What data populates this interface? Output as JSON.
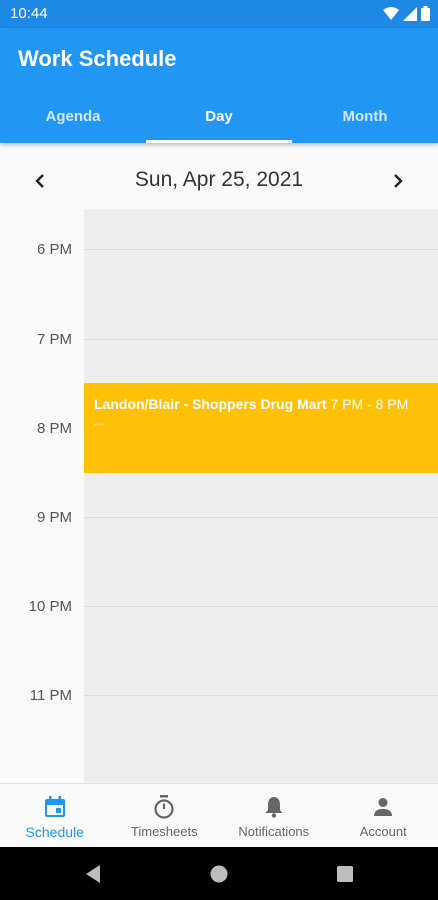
{
  "status_bar": {
    "time": "10:44"
  },
  "app": {
    "title": "Work Schedule"
  },
  "tabs": [
    {
      "label": "Agenda",
      "active": false
    },
    {
      "label": "Day",
      "active": true
    },
    {
      "label": "Month",
      "active": false
    }
  ],
  "date_nav": {
    "date": "Sun, Apr 25, 2021"
  },
  "timeline": {
    "hours": [
      "6 PM",
      "7 PM",
      "8 PM",
      "9 PM",
      "10 PM",
      "11 PM"
    ]
  },
  "event": {
    "title": "Landon/Blair - Shoppers Drug Mart",
    "time": "7 PM - 8 PM",
    "extra": "..."
  },
  "bottom_nav": [
    {
      "label": "Schedule",
      "icon": "calendar-icon",
      "active": true
    },
    {
      "label": "Timesheets",
      "icon": "stopwatch-icon",
      "active": false
    },
    {
      "label": "Notifications",
      "icon": "bell-icon",
      "active": false
    },
    {
      "label": "Account",
      "icon": "person-icon",
      "active": false
    }
  ],
  "colors": {
    "primary": "#2196f3",
    "status_bar": "#1e88e5",
    "event": "#ffc107"
  }
}
